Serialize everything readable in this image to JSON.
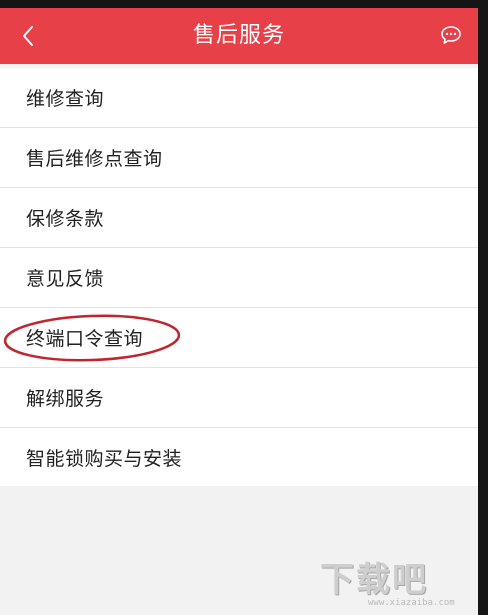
{
  "navbar": {
    "title": "售后服务",
    "back_icon": "chevron-left-icon",
    "message_icon": "chat-bubble-icon",
    "bg_color": "#e74049"
  },
  "menu": {
    "items": [
      {
        "label": "维修查询"
      },
      {
        "label": "售后维修点查询"
      },
      {
        "label": "保修条款"
      },
      {
        "label": "意见反馈"
      },
      {
        "label": "终端口令查询"
      },
      {
        "label": "解绑服务"
      },
      {
        "label": "智能锁购买与安装"
      }
    ]
  },
  "annotation": {
    "target": "终端口令查询",
    "color": "#c0242c"
  },
  "watermark": {
    "text": "下载吧",
    "url": "www.xiazaiba.com"
  }
}
